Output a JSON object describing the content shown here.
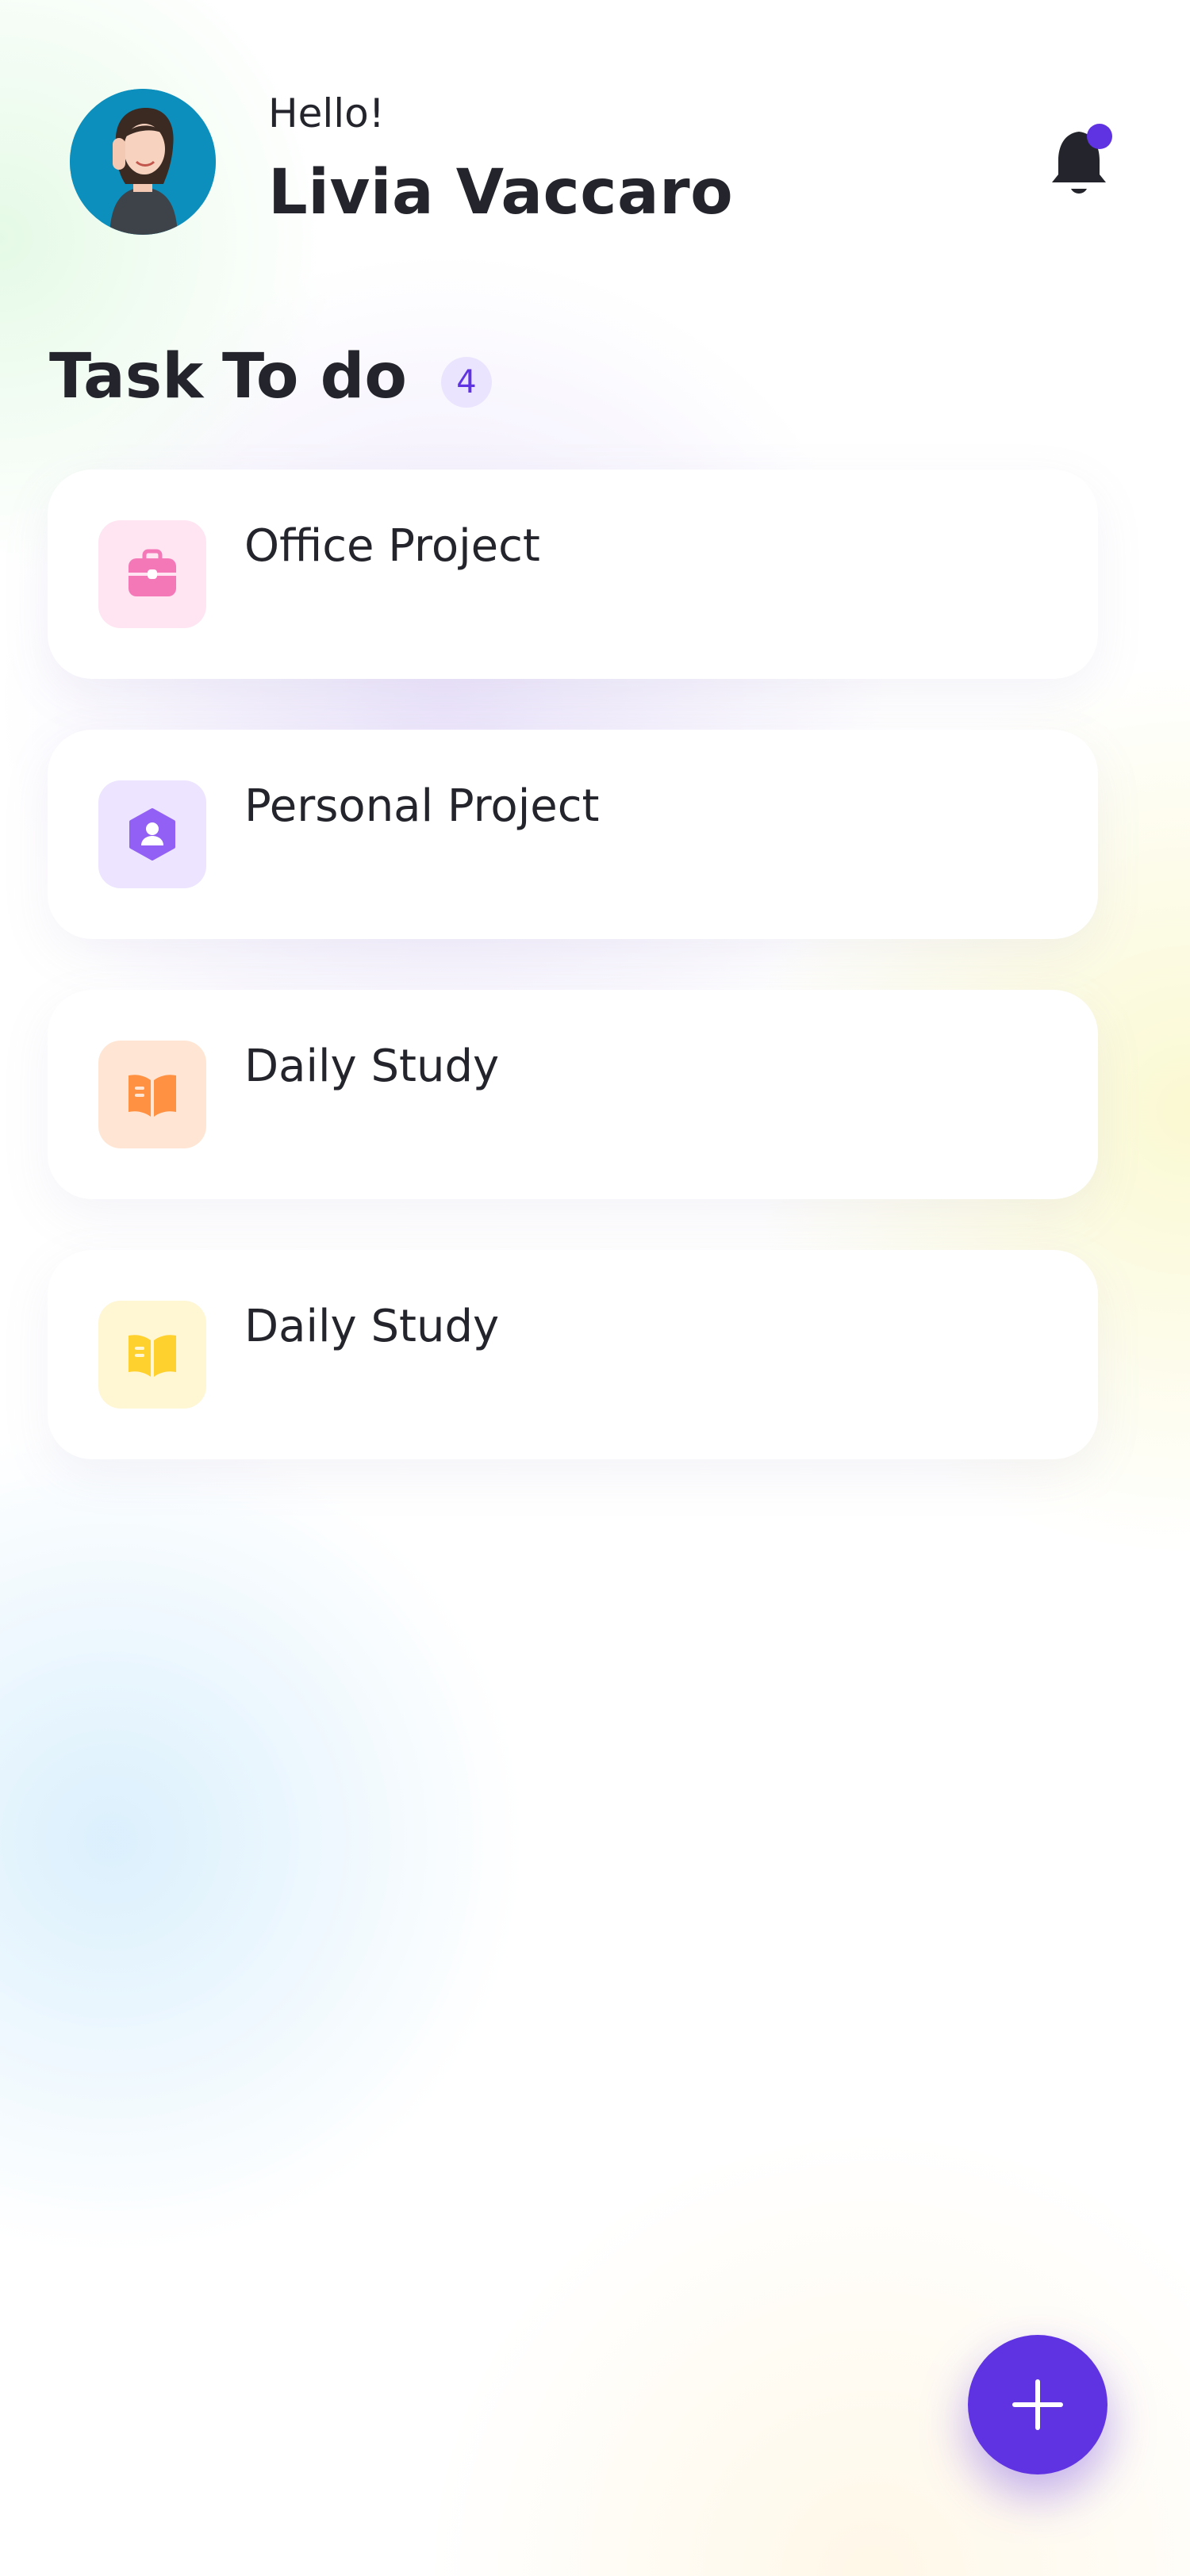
{
  "header": {
    "greeting": "Hello!",
    "user_name": "Livia Vaccaro",
    "avatar_icon": "avatar",
    "notification_icon": "bell-icon",
    "notification_dot_color": "#5f33e1"
  },
  "section": {
    "title": "Task",
    "subtitle": "To do",
    "count": "4"
  },
  "tasks": [
    {
      "title": "Office Project",
      "icon": "briefcase-icon",
      "icon_color": "#f478b8",
      "bg_color": "#ffe4f2"
    },
    {
      "title": "Personal Project",
      "icon": "user-hexagon-icon",
      "icon_color": "#9260f4",
      "bg_color": "#ede4ff"
    },
    {
      "title": "Daily Study",
      "icon": "book-icon",
      "icon_color": "#ff9142",
      "bg_color": "#ffe6d4"
    },
    {
      "title": "Daily Study",
      "icon": "book-icon",
      "icon_color": "#ffd12e",
      "bg_color": "#fff6d4"
    }
  ],
  "fab": {
    "icon": "plus-icon",
    "color": "#5f33e1"
  }
}
